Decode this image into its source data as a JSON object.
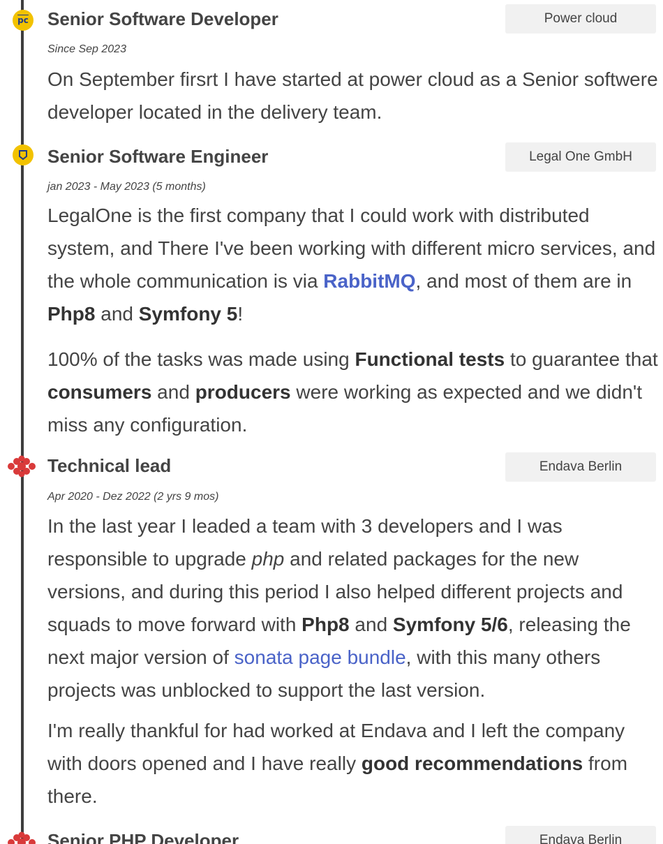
{
  "entries": [
    {
      "title": "Senior Software Developer",
      "company": "Power cloud",
      "period": "Since Sep 2023",
      "logo_text": "pc",
      "icon": "power-cloud-logo-icon",
      "paragraphs": [
        "On September firsrt I have started at power cloud as a Senior softwere developer located in the delivery team."
      ]
    },
    {
      "title": "Senior Software Engineer",
      "company": "Legal One GmbH",
      "period": "jan 2023 - May 2023 (5 months)",
      "icon": "legal-one-logo-icon",
      "p1": {
        "a": "LegalOne is the first company that I could work with distributed system, and There I've been working with different micro services, and the whole communication is via ",
        "link": "RabbitMQ",
        "b": ", and most of them are in ",
        "bold1": "Php8",
        "c": " and ",
        "bold2": "Symfony 5",
        "d": "!"
      },
      "p2": {
        "a": "100% of the tasks was made using ",
        "bold1": "Functional tests",
        "b": " to guarantee that ",
        "bold2": "consumers",
        "c": " and ",
        "bold3": "producers",
        "d": " were working as expected and we didn't miss any configuration."
      }
    },
    {
      "title": "Technical lead",
      "company": "Endava Berlin",
      "period": "Apr 2020 - Dez 2022 (2 yrs 9 mos)",
      "icon": "endava-logo-icon",
      "p1": {
        "a": "In the last year I leaded a team with 3 developers and I was responsible to upgrade ",
        "italic": "php",
        "b": " and related packages for the new versions, and during this period I also helped different projects and squads to move forward with ",
        "bold1": "Php8",
        "c": " and ",
        "bold2": "Symfony 5/6",
        "d": ", releasing the next major version of ",
        "link": "sonata page bundle",
        "e": ", with this many others projects was unblocked to support the last version."
      },
      "p2": {
        "a": "I'm really thankful for had worked at Endava and I left the company with doors opened and I have really ",
        "bold1": "good recommendations",
        "b": " from there."
      }
    },
    {
      "title": "Senior PHP Developer",
      "company": "Endava Berlin",
      "icon": "endava-logo-icon"
    }
  ],
  "colors": {
    "marker": "#f2c200",
    "timeline": "#3d3d3d",
    "link": "#4a63c8",
    "endava": "#d93a3a",
    "badge_bg": "#f1f1f1"
  }
}
